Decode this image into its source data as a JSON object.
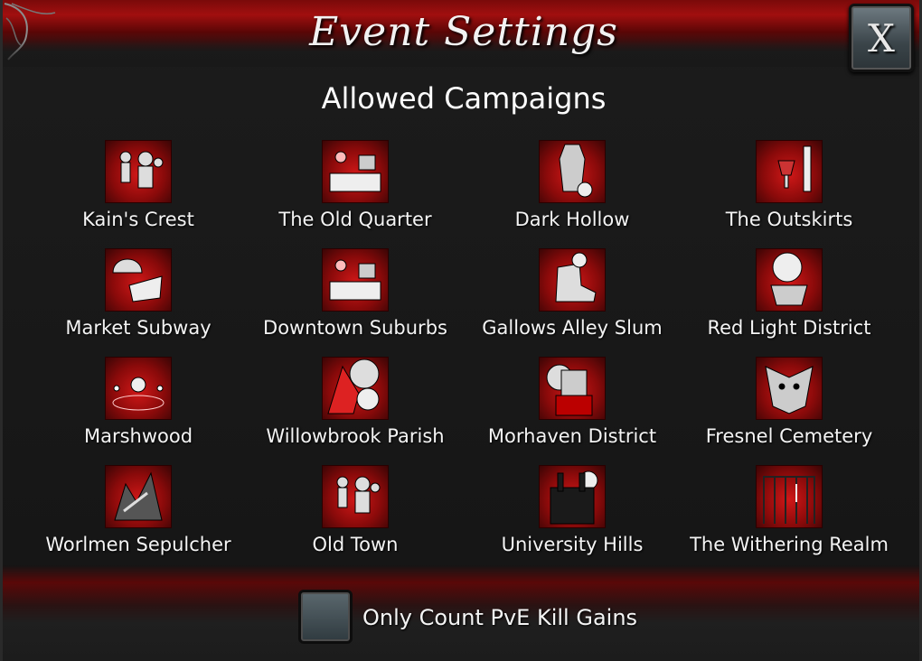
{
  "header": {
    "title": "Event Settings",
    "close_label": "X"
  },
  "section": {
    "title": "Allowed Campaigns"
  },
  "campaigns": [
    {
      "label": "Kain's Crest",
      "icon": "zombie-horde-icon"
    },
    {
      "label": "The Old Quarter",
      "icon": "ritual-table-icon"
    },
    {
      "label": "Dark Hollow",
      "icon": "coffin-skull-icon"
    },
    {
      "label": "The Outskirts",
      "icon": "wine-goblet-icon"
    },
    {
      "label": "Market Subway",
      "icon": "helmet-claw-icon"
    },
    {
      "label": "Downtown Suburbs",
      "icon": "ritual-table-icon"
    },
    {
      "label": "Gallows Alley Slum",
      "icon": "ruined-boot-icon"
    },
    {
      "label": "Red Light District",
      "icon": "werewolf-coffin-icon"
    },
    {
      "label": "Marshwood",
      "icon": "candle-circle-icon"
    },
    {
      "label": "Willowbrook Parish",
      "icon": "hooded-skull-icon"
    },
    {
      "label": "Morhaven District",
      "icon": "armored-priest-icon"
    },
    {
      "label": "Fresnel Cemetery",
      "icon": "beast-face-icon"
    },
    {
      "label": "Worlmen Sepulcher",
      "icon": "gnarled-tree-icon"
    },
    {
      "label": "Old Town",
      "icon": "zombie-horde-icon"
    },
    {
      "label": "University Hills",
      "icon": "cathedral-icon"
    },
    {
      "label": "The Withering Realm",
      "icon": "gallows-gate-icon"
    }
  ],
  "footer": {
    "checkbox_label": "Only Count PvE Kill Gains",
    "checkbox_checked": false
  }
}
